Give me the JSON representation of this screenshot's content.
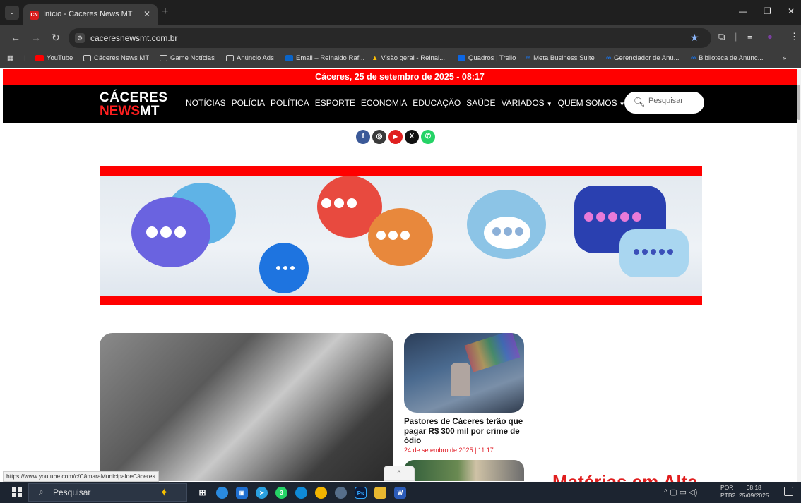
{
  "browser": {
    "tab_title": "Início - Cáceres News MT",
    "tab_favicon": "CN",
    "new_tab": "+",
    "url": "caceresnewsmt.com.br",
    "bookmarks": [
      {
        "label": "YouTube",
        "icon": "youtube-icon"
      },
      {
        "label": "Cáceres News MT",
        "icon": "folder-icon"
      },
      {
        "label": "Game Notícias",
        "icon": "folder-icon"
      },
      {
        "label": "Anúncio Ads",
        "icon": "folder-icon"
      },
      {
        "label": "Email – Reinaldo Raf...",
        "icon": "outlook-icon"
      },
      {
        "label": "Visão geral - Reinal...",
        "icon": "google-ads-icon"
      },
      {
        "label": "Quadros | Trello",
        "icon": "trello-icon"
      },
      {
        "label": "Meta Business Suite",
        "icon": "meta-icon"
      },
      {
        "label": "Gerenciador de Anú...",
        "icon": "meta-icon"
      },
      {
        "label": "Biblioteca de Anúnc...",
        "icon": "meta-icon"
      }
    ],
    "status_url": "https://www.youtube.com/c/CâmaraMunicipaldeCáceres"
  },
  "site": {
    "date_banner": "Cáceres, 25 de setembro de 2025 - 08:17",
    "logo_line1": "CÁCERES",
    "logo_news": "NEWS",
    "logo_mt": "MT",
    "nav": [
      {
        "label": "NOTÍCIAS",
        "dropdown": false
      },
      {
        "label": "POLÍCIA",
        "dropdown": false
      },
      {
        "label": "POLÍTICA",
        "dropdown": false
      },
      {
        "label": "ESPORTE",
        "dropdown": false
      },
      {
        "label": "ECONOMIA",
        "dropdown": false
      },
      {
        "label": "EDUCAÇÃO",
        "dropdown": false
      },
      {
        "label": "SAÚDE",
        "dropdown": false
      },
      {
        "label": "VARIADOS",
        "dropdown": true
      },
      {
        "label": "QUEM SOMOS",
        "dropdown": true
      }
    ],
    "search_placeholder": "Pesquisar",
    "social": [
      {
        "name": "facebook-icon",
        "glyph": "f",
        "color": "#3b5998"
      },
      {
        "name": "instagram-icon",
        "glyph": "◎",
        "color": "#3a3a3a"
      },
      {
        "name": "youtube-icon",
        "glyph": "▶",
        "color": "#e02020"
      },
      {
        "name": "x-icon",
        "glyph": "X",
        "color": "#111111"
      },
      {
        "name": "whatsapp-icon",
        "glyph": "✆",
        "color": "#25d366"
      }
    ],
    "article": {
      "title": "Pastores de Cáceres terão que pagar R$ 300 mil por crime de ódio",
      "date": "24 de setembro de 2025 | 11:17"
    },
    "trending_title": "Matérias em Alta",
    "scroll_top": "^"
  },
  "taskbar": {
    "search_text": "Pesquisar",
    "whatsapp_badge": "3",
    "lang_top": "POR",
    "lang_bottom": "PTB2",
    "time": "08:18",
    "date": "25/09/2025"
  },
  "colors": {
    "brand_red": "#ff0000",
    "header_black": "#000000",
    "date_red": "#e0141e"
  }
}
